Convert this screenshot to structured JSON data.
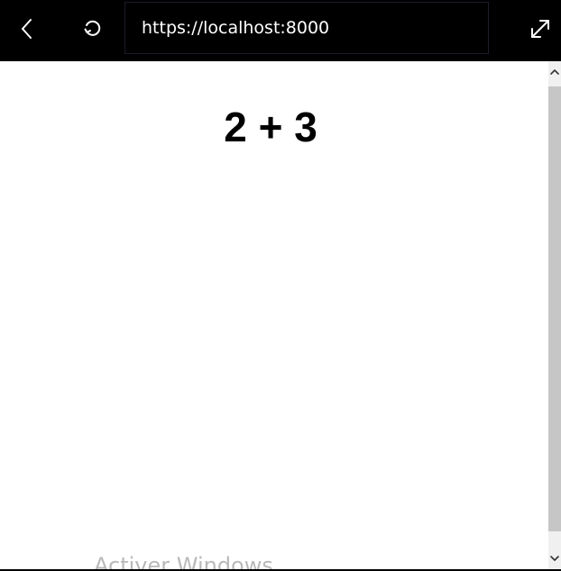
{
  "toolbar": {
    "background": "#000000",
    "back_icon": "chevron-left-icon",
    "reload_icon": "reload-icon",
    "expand_icon": "expand-icon",
    "url": "https://localhost:8000"
  },
  "main": {
    "question": "2 + 3"
  },
  "overlay": {
    "watermark": "Activer Windows"
  },
  "scrollbar": {
    "up_icon": "chevron-up-icon",
    "down_icon": "chevron-down-icon"
  }
}
